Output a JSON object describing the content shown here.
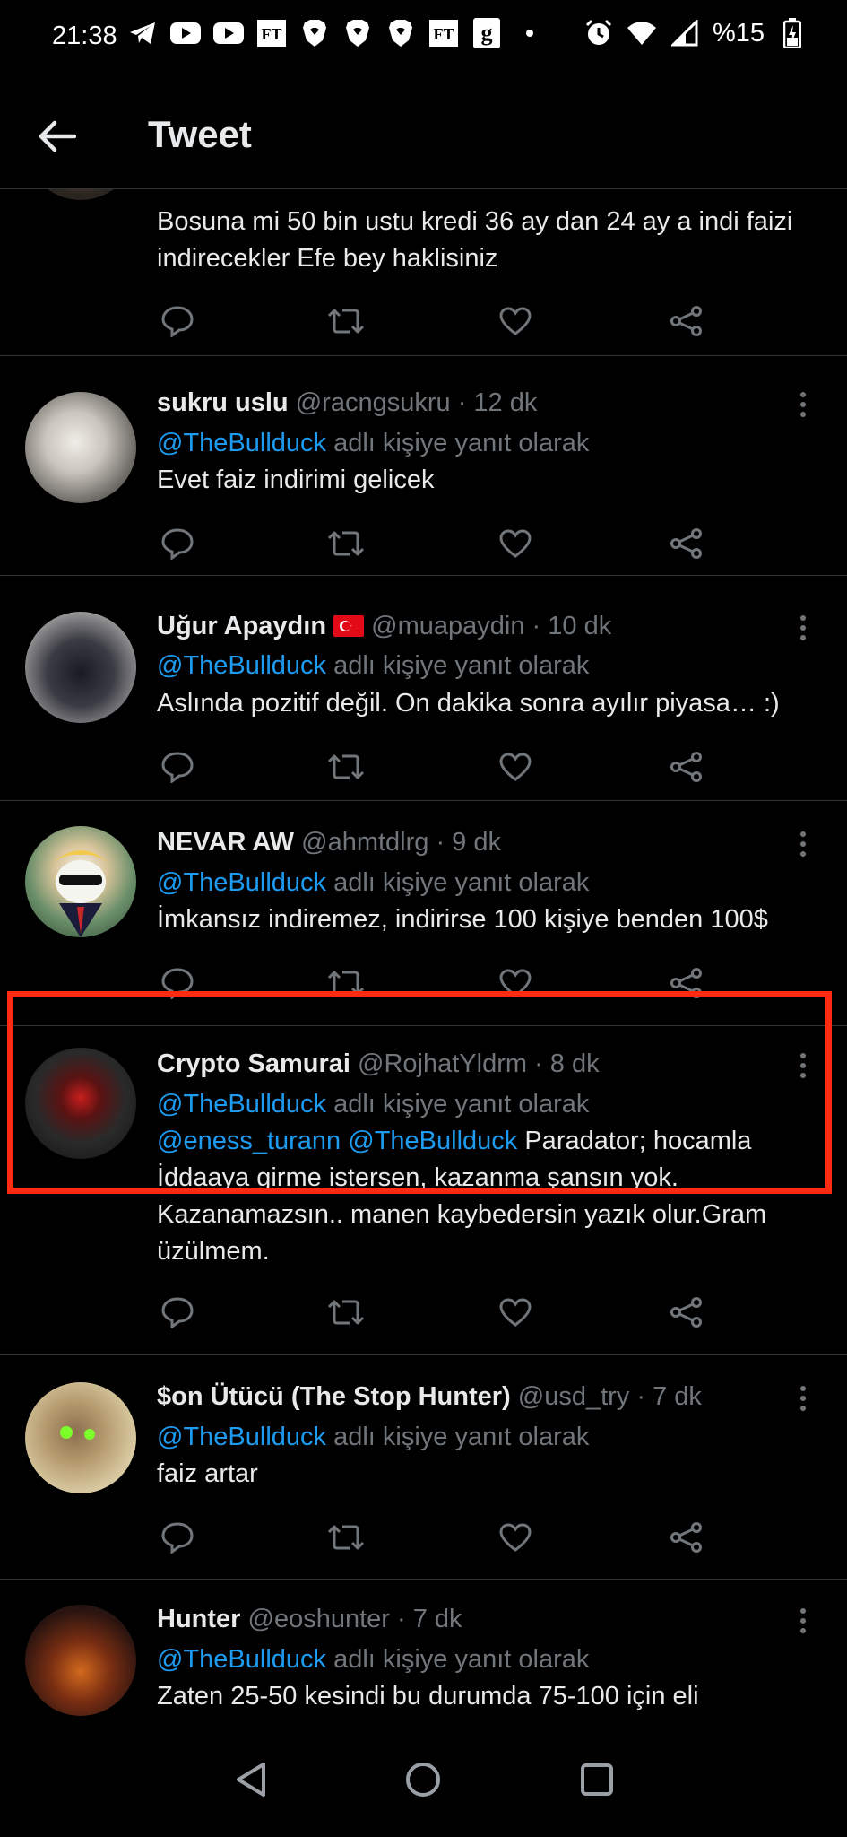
{
  "status_bar": {
    "time": "21:38",
    "battery_text": "%15",
    "notification_icons": [
      "telegram-icon",
      "youtube-icon",
      "youtube-icon",
      "ft-icon",
      "brave-icon",
      "brave-icon",
      "brave-icon",
      "ft-icon",
      "g-icon",
      "dot-icon"
    ]
  },
  "header": {
    "title": "Tweet"
  },
  "reply_prefix": "@TheBullduck",
  "reply_suffix": " adlı kişiye yanıt olarak",
  "tweets": [
    {
      "name": "",
      "handle": "",
      "time": "",
      "text": "Bosuna mi 50 bin ustu kredi 36 ay dan 24 ay a indi faizi indirecekler Efe bey haklisiniz"
    },
    {
      "name": "sukru uslu",
      "handle": "@racngsukru",
      "time": "· 12 dk",
      "text": "Evet faiz indirimi gelicek"
    },
    {
      "name": "Uğur Apaydın",
      "handle": "@muapaydin",
      "time": "· 10 dk",
      "text": "Aslında pozitif değil. On dakika sonra ayılır piyasa… :)"
    },
    {
      "name": "NEVAR AW",
      "handle": "@ahmtdlrg",
      "time": "· 9 dk",
      "text": "İmkansız indiremez, indirirse 100 kişiye benden 100$"
    },
    {
      "name": "Crypto Samurai",
      "handle": "@RojhatYldrm",
      "time": "· 8 dk",
      "mention1": "@eness_turann",
      "mention2": "@TheBullduck",
      "text": "Paradator; hocamla İddaaya girme istersen, kazanma şansın yok. Kazanamazsın.. manen kaybedersin yazık olur.Gram üzülmem."
    },
    {
      "name": "$on Ütücü (The Stop Hunter)",
      "handle": "@usd_try",
      "time": "· 7 dk",
      "text": "faiz artar"
    },
    {
      "name": "Hunter",
      "handle": "@eoshunter",
      "time": "· 7 dk",
      "text": "Zaten 25-50 kesindi bu durumda 75-100 için eli"
    }
  ],
  "colors": {
    "accent": "#1d9bf0",
    "highlight": "#ff2a12",
    "muted": "#71767b",
    "background": "#000000"
  }
}
